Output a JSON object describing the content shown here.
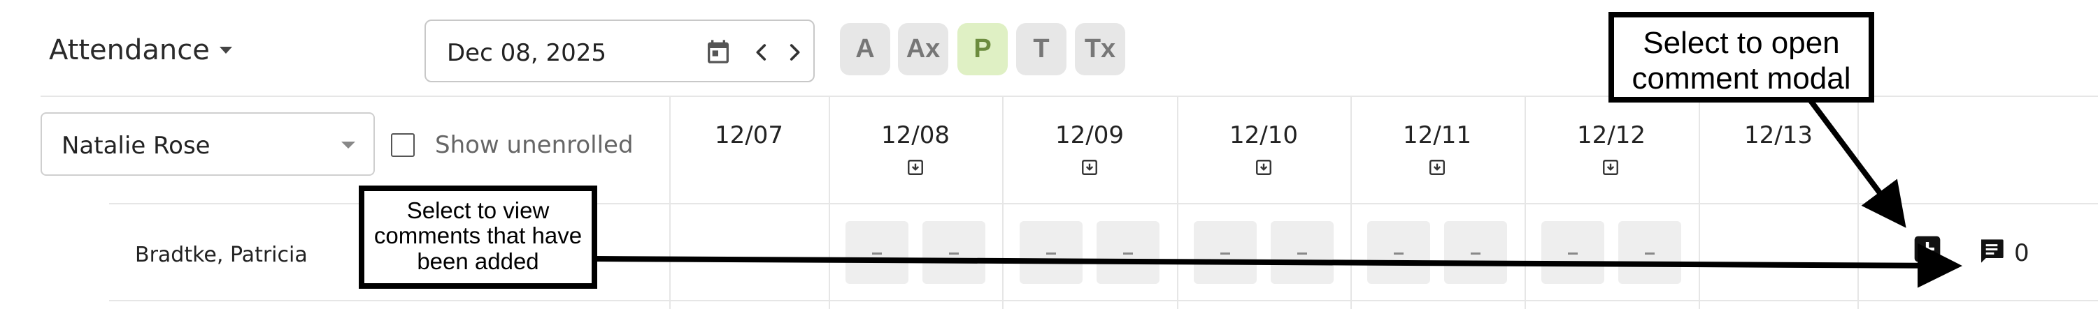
{
  "header": {
    "title": "Attendance",
    "date_value": "Dec 08, 2025",
    "status_buttons": [
      {
        "label": "A",
        "active": false
      },
      {
        "label": "Ax",
        "active": false
      },
      {
        "label": "P",
        "active": true
      },
      {
        "label": "T",
        "active": false
      },
      {
        "label": "Tx",
        "active": false
      }
    ]
  },
  "filters": {
    "student_select_value": "Natalie Rose",
    "show_unenrolled_label": "Show unenrolled",
    "show_unenrolled_checked": false
  },
  "columns": [
    "12/07",
    "12/08",
    "12/09",
    "12/10",
    "12/11",
    "12/12",
    "12/13"
  ],
  "rows": [
    {
      "name": "Bradtke, Patricia",
      "comment_count": "0"
    }
  ],
  "callouts": {
    "view_comments": "Select to view comments that have been added",
    "open_modal": "Select to open comment modal"
  },
  "colors": {
    "active_status_bg": "#dff0c4",
    "active_status_fg": "#6c8c3e",
    "inactive_status_bg": "#e7e7e7",
    "grid_line": "#e6e6e6",
    "cell_bg": "#eeeeee"
  },
  "icons": {
    "calendar": "calendar-icon",
    "prev": "chevron-left-icon",
    "next": "chevron-right-icon",
    "download": "download-icon",
    "add_comment": "add-comment-icon",
    "comment": "comment-icon"
  }
}
